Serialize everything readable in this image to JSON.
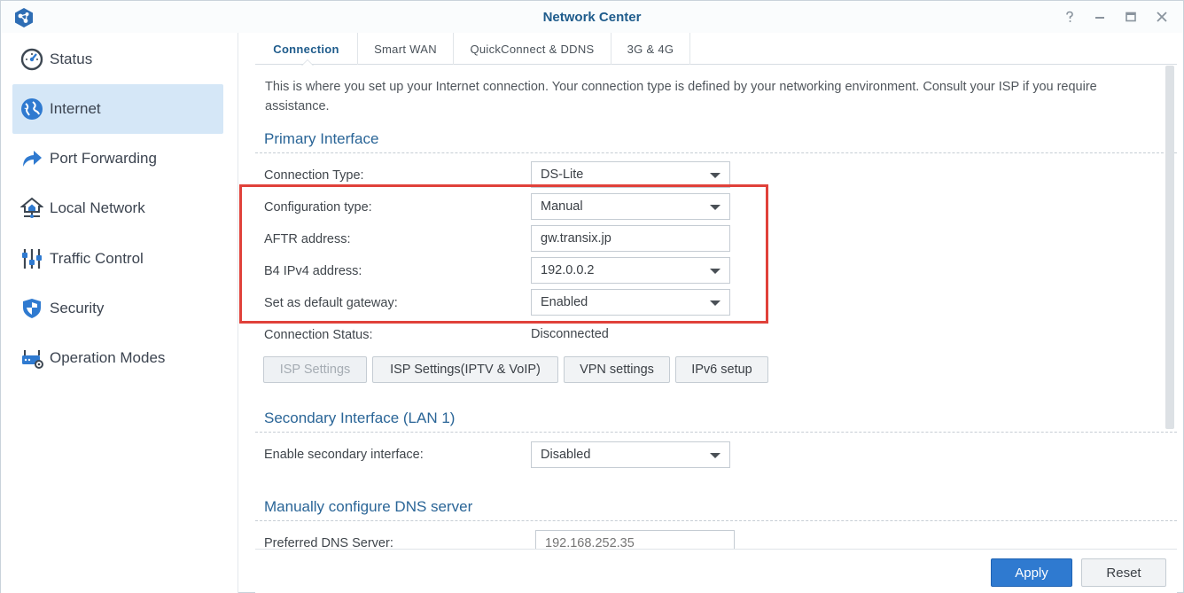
{
  "window": {
    "title": "Network Center",
    "controls": [
      "help-icon",
      "minimize-icon",
      "maximize-icon",
      "close-icon"
    ]
  },
  "sidebar": {
    "items": [
      {
        "label": "Status",
        "icon": "status-gauge-icon",
        "active": false
      },
      {
        "label": "Internet",
        "icon": "globe-icon",
        "active": true
      },
      {
        "label": "Port Forwarding",
        "icon": "forward-arrow-icon",
        "active": false
      },
      {
        "label": "Local Network",
        "icon": "home-network-icon",
        "active": false
      },
      {
        "label": "Traffic Control",
        "icon": "sliders-icon",
        "active": false
      },
      {
        "label": "Security",
        "icon": "shield-icon",
        "active": false
      },
      {
        "label": "Operation Modes",
        "icon": "router-gear-icon",
        "active": false
      }
    ]
  },
  "tabs": [
    {
      "label": "Connection",
      "active": true
    },
    {
      "label": "Smart WAN",
      "active": false
    },
    {
      "label": "QuickConnect & DDNS",
      "active": false
    },
    {
      "label": "3G & 4G",
      "active": false
    }
  ],
  "connection": {
    "description": "This is where you set up your Internet connection. Your connection type is defined by your networking environment. Consult your ISP if you require assistance.",
    "primary": {
      "title": "Primary Interface",
      "connection_type_label": "Connection Type:",
      "connection_type_value": "DS-Lite",
      "config_type_label": "Configuration type:",
      "config_type_value": "Manual",
      "aftr_label": "AFTR address:",
      "aftr_value": "gw.transix.jp",
      "b4_label": "B4 IPv4 address:",
      "b4_value": "192.0.0.2",
      "gateway_label": "Set as default gateway:",
      "gateway_value": "Enabled",
      "status_label": "Connection Status:",
      "status_value": "Disconnected",
      "buttons": {
        "isp_settings": "ISP Settings",
        "isp_iptv": "ISP Settings(IPTV & VoIP)",
        "vpn": "VPN settings",
        "ipv6": "IPv6 setup"
      }
    },
    "secondary": {
      "title": "Secondary Interface (LAN 1)",
      "enable_label": "Enable secondary interface:",
      "enable_value": "Disabled"
    },
    "dns": {
      "title": "Manually configure DNS server",
      "preferred_label": "Preferred DNS Server:",
      "preferred_placeholder": "192.168.252.35"
    }
  },
  "footer": {
    "apply": "Apply",
    "reset": "Reset"
  },
  "colors": {
    "accent": "#2f7ad0",
    "title": "#1f5c8c",
    "active_nav_bg": "#d5e7f7",
    "highlight_border": "#e0413a"
  }
}
